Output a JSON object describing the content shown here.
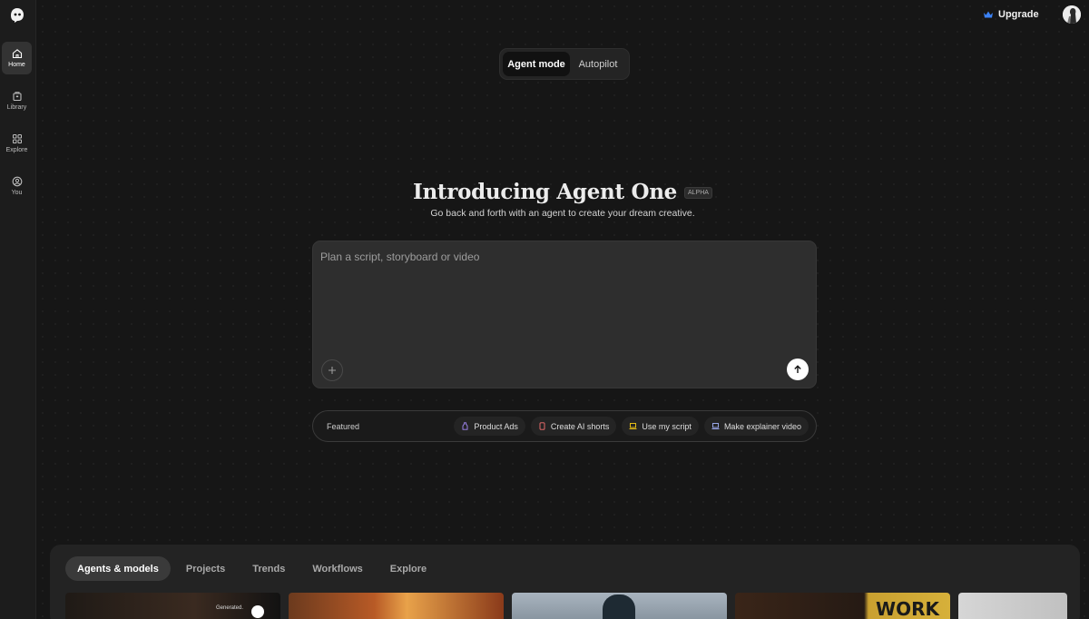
{
  "sidebar": {
    "items": [
      {
        "label": "Home",
        "icon": "home-icon",
        "active": true
      },
      {
        "label": "Library",
        "icon": "library-icon",
        "active": false
      },
      {
        "label": "Explore",
        "icon": "grid-icon",
        "active": false
      },
      {
        "label": "You",
        "icon": "user-circle-icon",
        "active": false
      }
    ]
  },
  "header": {
    "upgrade_label": "Upgrade",
    "upgrade_icon": "crown-icon",
    "accent": "#3b82f6"
  },
  "mode_toggle": {
    "options": [
      {
        "label": "Agent mode",
        "active": true
      },
      {
        "label": "Autopilot",
        "active": false
      }
    ]
  },
  "hero": {
    "title": "Introducing Agent One",
    "badge": "ALPHA",
    "subtitle": "Go back and forth with an agent to create your dream creative."
  },
  "prompt": {
    "placeholder": "Plan a script, storyboard or video",
    "value": ""
  },
  "featured": {
    "label": "Featured",
    "chips": [
      {
        "label": "Product Ads",
        "icon": "bottle-icon"
      },
      {
        "label": "Create AI shorts",
        "icon": "phone-icon"
      },
      {
        "label": "Use my script",
        "icon": "laptop-icon"
      },
      {
        "label": "Make explainer video",
        "icon": "laptop-icon"
      }
    ]
  },
  "bottom": {
    "tabs": [
      {
        "label": "Agents & models",
        "active": true
      },
      {
        "label": "Projects",
        "active": false
      },
      {
        "label": "Trends",
        "active": false
      },
      {
        "label": "Workflows",
        "active": false
      },
      {
        "label": "Explore",
        "active": false
      }
    ],
    "thumb_tag": "Generated.",
    "thumb_word": "WORK"
  }
}
